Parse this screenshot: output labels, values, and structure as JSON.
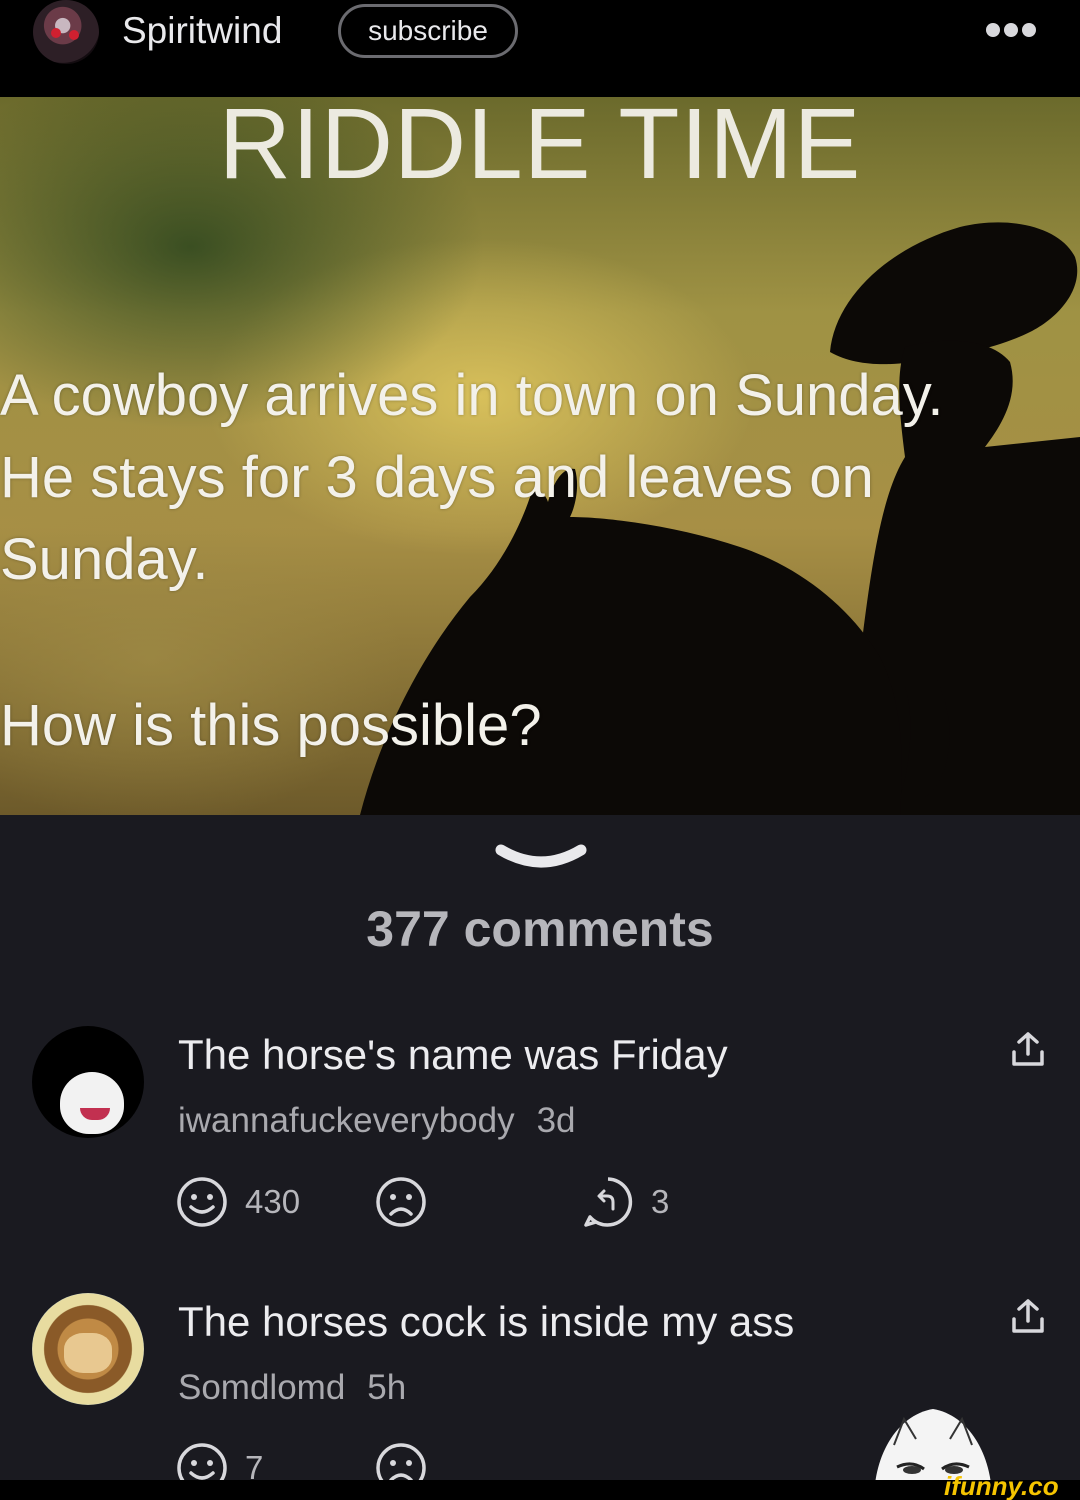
{
  "header": {
    "channel_name": "Spiritwind",
    "subscribe_label": "subscribe",
    "more_icon": "more-horizontal-icon"
  },
  "post": {
    "title": "RIDDLE TIME",
    "lines": [
      "A cowboy arrives in town on Sunday.",
      "He stays for 3 days and leaves on",
      "Sunday.",
      "How is this possible?"
    ]
  },
  "comments_section": {
    "count_label": "377 comments",
    "comments": [
      {
        "text": "The horse's name was Friday",
        "username": "iwannafuckeverybody",
        "time": "3d",
        "smile_count": "430",
        "reply_count": "3"
      },
      {
        "text": "The horses cock is inside my ass",
        "username": "Somdlomd",
        "time": "5h",
        "smile_count": "7"
      }
    ]
  },
  "watermark": {
    "label": "ifunny.co",
    "color": "#f5c400"
  },
  "colors": {
    "background": "#1a1a20",
    "topbar": "#000000",
    "text_primary": "#ececef",
    "text_secondary": "#a9a9ae"
  }
}
